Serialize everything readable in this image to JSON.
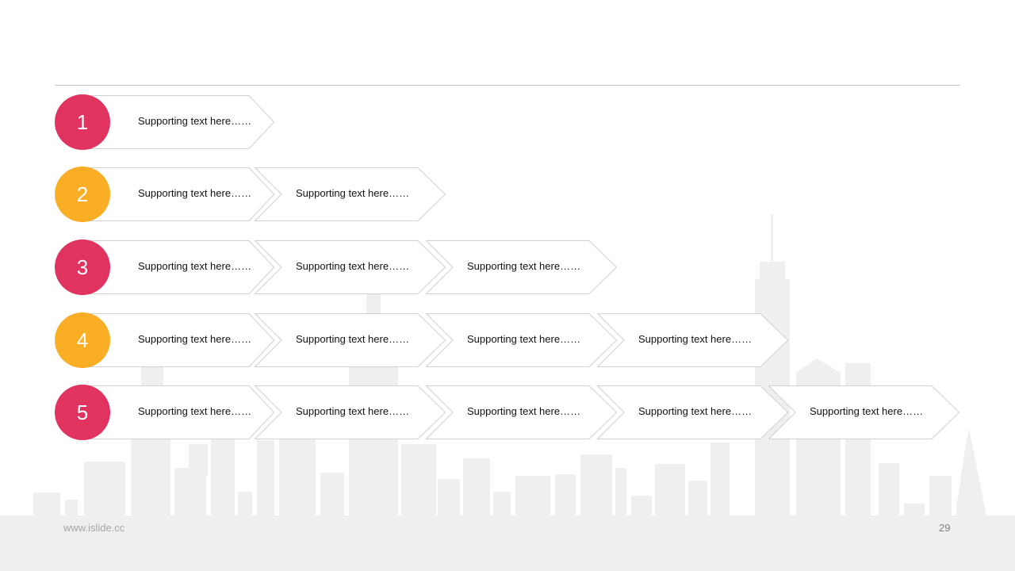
{
  "colors": {
    "pink": "#e0335f",
    "orange": "#f9ae26",
    "arrow_border": "#d0d0d0",
    "skyline": "#efefef"
  },
  "steps": [
    {
      "number": "1",
      "color": "#e0335f",
      "items": [
        "Supporting  text here……"
      ]
    },
    {
      "number": "2",
      "color": "#f9ae26",
      "items": [
        "Supporting  text here……",
        "Supporting  text here……"
      ]
    },
    {
      "number": "3",
      "color": "#e0335f",
      "items": [
        "Supporting  text here……",
        "Supporting  text here……",
        "Supporting  text here……"
      ]
    },
    {
      "number": "4",
      "color": "#f9ae26",
      "items": [
        "Supporting  text here……",
        "Supporting  text here……",
        "Supporting  text here……",
        "Supporting  text here……"
      ]
    },
    {
      "number": "5",
      "color": "#e0335f",
      "items": [
        "Supporting  text here……",
        "Supporting  text here……",
        "Supporting  text here……",
        "Supporting  text here……",
        "Supporting  text here……"
      ]
    }
  ],
  "footer": {
    "url": "www.islide.cc",
    "page_number": "29"
  }
}
